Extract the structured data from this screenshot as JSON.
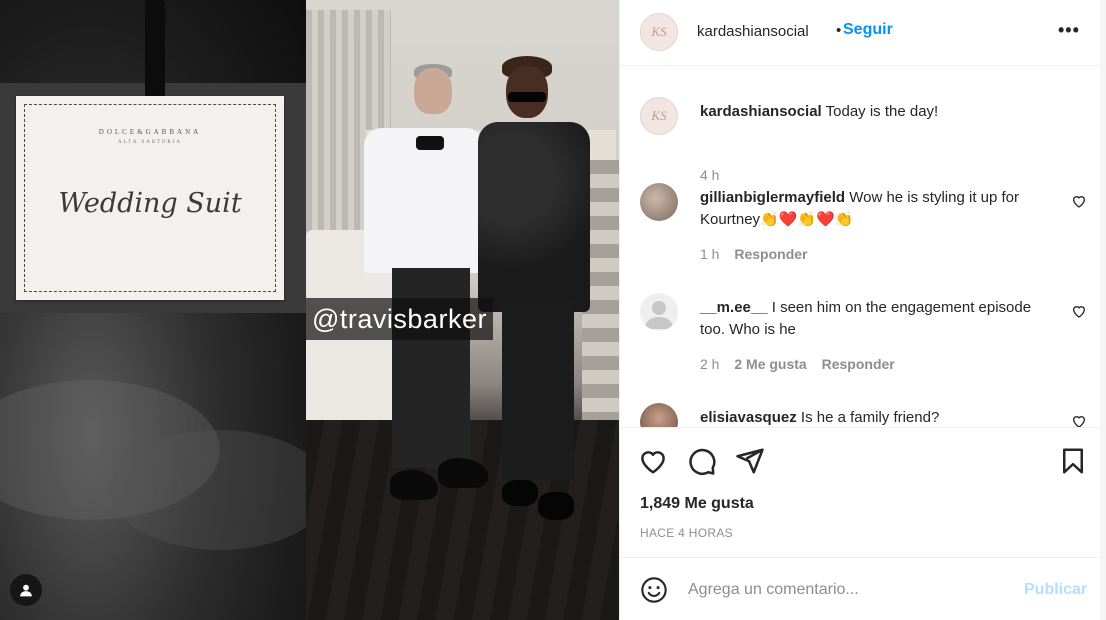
{
  "media": {
    "tag_brand": "DOLCE&GABBANA",
    "tag_subtitle": "ALTA SARTORIA",
    "tag_title": "Wedding Suit",
    "overlay_mention": "@travisbarker",
    "account_icon": "user-silhouette-icon"
  },
  "header": {
    "avatar_text": "KS",
    "username": "kardashiansocial",
    "separator": "•",
    "follow_label": "Seguir",
    "more_label": "•••"
  },
  "comments": [
    {
      "username": "kardashiansocial",
      "text": "Today is the day!",
      "time": "4 h",
      "likes": "",
      "reply": ""
    },
    {
      "username": "gillianbiglermayfield",
      "text": "Wow he is styling it up for Kourtney👏❤️👏❤️👏",
      "time": "1 h",
      "likes": "",
      "reply": "Responder"
    },
    {
      "username": "__m.ee__",
      "text": "I seen him on the engagement episode too. Who is he",
      "time": "2 h",
      "likes": "2 Me gusta",
      "reply": "Responder"
    },
    {
      "username": "elisiavasquez",
      "text": "Is he a family friend?",
      "time": "",
      "likes": "",
      "reply": ""
    }
  ],
  "actions": {
    "like_icon": "heart-icon",
    "comment_icon": "comment-bubble-icon",
    "share_icon": "paper-plane-icon",
    "save_icon": "bookmark-icon",
    "likes_count": "1,849 Me gusta",
    "timestamp": "HACE 4 HORAS"
  },
  "composer": {
    "emoji_icon": "smiley-icon",
    "placeholder": "Agrega un comentario...",
    "post_label": "Publicar"
  },
  "colors": {
    "accent": "#0095f6",
    "post_disabled": "#b2dffc",
    "muted_text": "#8e8e8e",
    "border": "#efefef"
  }
}
